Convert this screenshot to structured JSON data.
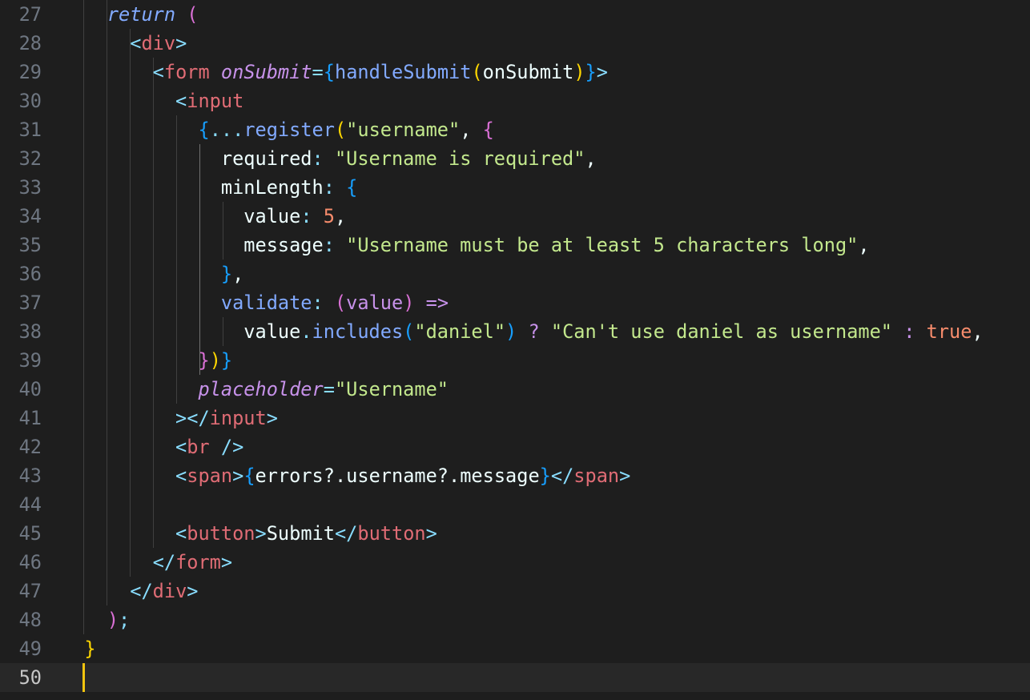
{
  "editor": {
    "lines": [
      {
        "number": "27",
        "tokens": [
          {
            "t": "    ",
            "c": ""
          },
          {
            "t": "return",
            "c": "t-kw"
          },
          {
            "t": " ",
            "c": ""
          },
          {
            "t": "(",
            "c": "t-b2"
          }
        ]
      },
      {
        "number": "28",
        "tokens": [
          {
            "t": "      ",
            "c": ""
          },
          {
            "t": "<",
            "c": "t-pun"
          },
          {
            "t": "div",
            "c": "t-tag"
          },
          {
            "t": ">",
            "c": "t-pun"
          }
        ]
      },
      {
        "number": "29",
        "tokens": [
          {
            "t": "        ",
            "c": ""
          },
          {
            "t": "<",
            "c": "t-pun"
          },
          {
            "t": "form",
            "c": "t-tag"
          },
          {
            "t": " ",
            "c": ""
          },
          {
            "t": "onSubmit",
            "c": "t-attr"
          },
          {
            "t": "=",
            "c": "t-pun"
          },
          {
            "t": "{",
            "c": "t-b3"
          },
          {
            "t": "handleSubmit",
            "c": "t-fn"
          },
          {
            "t": "(",
            "c": "t-b1"
          },
          {
            "t": "onSubmit",
            "c": "t-txt"
          },
          {
            "t": ")",
            "c": "t-b1"
          },
          {
            "t": "}",
            "c": "t-b3"
          },
          {
            "t": ">",
            "c": "t-pun"
          }
        ]
      },
      {
        "number": "30",
        "tokens": [
          {
            "t": "          ",
            "c": ""
          },
          {
            "t": "<",
            "c": "t-pun"
          },
          {
            "t": "input",
            "c": "t-tag"
          }
        ]
      },
      {
        "number": "31",
        "tokens": [
          {
            "t": "            ",
            "c": ""
          },
          {
            "t": "{",
            "c": "t-b3"
          },
          {
            "t": "...",
            "c": "t-pun"
          },
          {
            "t": "register",
            "c": "t-fn"
          },
          {
            "t": "(",
            "c": "t-b1"
          },
          {
            "t": "\"username\"",
            "c": "t-str"
          },
          {
            "t": ", ",
            "c": "t-txt"
          },
          {
            "t": "{",
            "c": "t-b2"
          }
        ]
      },
      {
        "number": "32",
        "tokens": [
          {
            "t": "              ",
            "c": ""
          },
          {
            "t": "required",
            "c": "t-txt"
          },
          {
            "t": ": ",
            "c": "t-pun"
          },
          {
            "t": "\"Username is required\"",
            "c": "t-str"
          },
          {
            "t": ",",
            "c": "t-txt"
          }
        ]
      },
      {
        "number": "33",
        "tokens": [
          {
            "t": "              ",
            "c": ""
          },
          {
            "t": "minLength",
            "c": "t-txt"
          },
          {
            "t": ": ",
            "c": "t-pun"
          },
          {
            "t": "{",
            "c": "t-b3"
          }
        ]
      },
      {
        "number": "34",
        "tokens": [
          {
            "t": "                ",
            "c": ""
          },
          {
            "t": "value",
            "c": "t-txt"
          },
          {
            "t": ": ",
            "c": "t-pun"
          },
          {
            "t": "5",
            "c": "t-num"
          },
          {
            "t": ",",
            "c": "t-txt"
          }
        ]
      },
      {
        "number": "35",
        "tokens": [
          {
            "t": "                ",
            "c": ""
          },
          {
            "t": "message",
            "c": "t-txt"
          },
          {
            "t": ": ",
            "c": "t-pun"
          },
          {
            "t": "\"Username must be at least 5 characters long\"",
            "c": "t-str"
          },
          {
            "t": ",",
            "c": "t-txt"
          }
        ]
      },
      {
        "number": "36",
        "tokens": [
          {
            "t": "              ",
            "c": ""
          },
          {
            "t": "}",
            "c": "t-b3"
          },
          {
            "t": ",",
            "c": "t-txt"
          }
        ]
      },
      {
        "number": "37",
        "tokens": [
          {
            "t": "              ",
            "c": ""
          },
          {
            "t": "validate",
            "c": "t-fn"
          },
          {
            "t": ": ",
            "c": "t-pun"
          },
          {
            "t": "(",
            "c": "t-b2"
          },
          {
            "t": "value",
            "c": "t-op"
          },
          {
            "t": ")",
            "c": "t-b2"
          },
          {
            "t": " ",
            "c": ""
          },
          {
            "t": "=>",
            "c": "t-op"
          }
        ]
      },
      {
        "number": "38",
        "tokens": [
          {
            "t": "                ",
            "c": ""
          },
          {
            "t": "value",
            "c": "t-txt"
          },
          {
            "t": ".",
            "c": "t-pun"
          },
          {
            "t": "includes",
            "c": "t-fn"
          },
          {
            "t": "(",
            "c": "t-b3"
          },
          {
            "t": "\"daniel\"",
            "c": "t-str"
          },
          {
            "t": ")",
            "c": "t-b3"
          },
          {
            "t": " ? ",
            "c": "t-op"
          },
          {
            "t": "\"Can't use daniel as username\"",
            "c": "t-str"
          },
          {
            "t": " : ",
            "c": "t-op"
          },
          {
            "t": "true",
            "c": "t-bool"
          },
          {
            "t": ",",
            "c": "t-txt"
          }
        ]
      },
      {
        "number": "39",
        "tokens": [
          {
            "t": "            ",
            "c": ""
          },
          {
            "t": "}",
            "c": "t-b2"
          },
          {
            "t": ")",
            "c": "t-b1"
          },
          {
            "t": "}",
            "c": "t-b3"
          }
        ]
      },
      {
        "number": "40",
        "tokens": [
          {
            "t": "            ",
            "c": ""
          },
          {
            "t": "placeholder",
            "c": "t-attr"
          },
          {
            "t": "=",
            "c": "t-pun"
          },
          {
            "t": "\"Username\"",
            "c": "t-str"
          }
        ]
      },
      {
        "number": "41",
        "tokens": [
          {
            "t": "          ",
            "c": ""
          },
          {
            "t": "></",
            "c": "t-pun"
          },
          {
            "t": "input",
            "c": "t-tag"
          },
          {
            "t": ">",
            "c": "t-pun"
          }
        ]
      },
      {
        "number": "42",
        "tokens": [
          {
            "t": "          ",
            "c": ""
          },
          {
            "t": "<",
            "c": "t-pun"
          },
          {
            "t": "br",
            "c": "t-tag"
          },
          {
            "t": " />",
            "c": "t-pun"
          }
        ]
      },
      {
        "number": "43",
        "tokens": [
          {
            "t": "          ",
            "c": ""
          },
          {
            "t": "<",
            "c": "t-pun"
          },
          {
            "t": "span",
            "c": "t-tag"
          },
          {
            "t": ">",
            "c": "t-pun"
          },
          {
            "t": "{",
            "c": "t-b3"
          },
          {
            "t": "errors?.username?.message",
            "c": "t-txt"
          },
          {
            "t": "}",
            "c": "t-b3"
          },
          {
            "t": "</",
            "c": "t-pun"
          },
          {
            "t": "span",
            "c": "t-tag"
          },
          {
            "t": ">",
            "c": "t-pun"
          }
        ]
      },
      {
        "number": "44",
        "tokens": []
      },
      {
        "number": "45",
        "tokens": [
          {
            "t": "          ",
            "c": ""
          },
          {
            "t": "<",
            "c": "t-pun"
          },
          {
            "t": "button",
            "c": "t-tag"
          },
          {
            "t": ">",
            "c": "t-pun"
          },
          {
            "t": "Submit",
            "c": "t-txt"
          },
          {
            "t": "</",
            "c": "t-pun"
          },
          {
            "t": "button",
            "c": "t-tag"
          },
          {
            "t": ">",
            "c": "t-pun"
          }
        ]
      },
      {
        "number": "46",
        "tokens": [
          {
            "t": "        ",
            "c": ""
          },
          {
            "t": "</",
            "c": "t-pun"
          },
          {
            "t": "form",
            "c": "t-tag"
          },
          {
            "t": ">",
            "c": "t-pun"
          }
        ]
      },
      {
        "number": "47",
        "tokens": [
          {
            "t": "      ",
            "c": ""
          },
          {
            "t": "</",
            "c": "t-pun"
          },
          {
            "t": "div",
            "c": "t-tag"
          },
          {
            "t": ">",
            "c": "t-pun"
          }
        ]
      },
      {
        "number": "48",
        "tokens": [
          {
            "t": "    ",
            "c": ""
          },
          {
            "t": ")",
            "c": "t-b2"
          },
          {
            "t": ";",
            "c": "t-pun"
          }
        ]
      },
      {
        "number": "49",
        "tokens": [
          {
            "t": "  ",
            "c": ""
          },
          {
            "t": "}",
            "c": "t-b1"
          }
        ]
      },
      {
        "number": "50",
        "tokens": [],
        "current": true
      }
    ],
    "colors": {
      "background": "#1e1e1e",
      "current_line": "#282828",
      "cursor": "#f1c40f",
      "line_number": "#6e7681"
    }
  }
}
